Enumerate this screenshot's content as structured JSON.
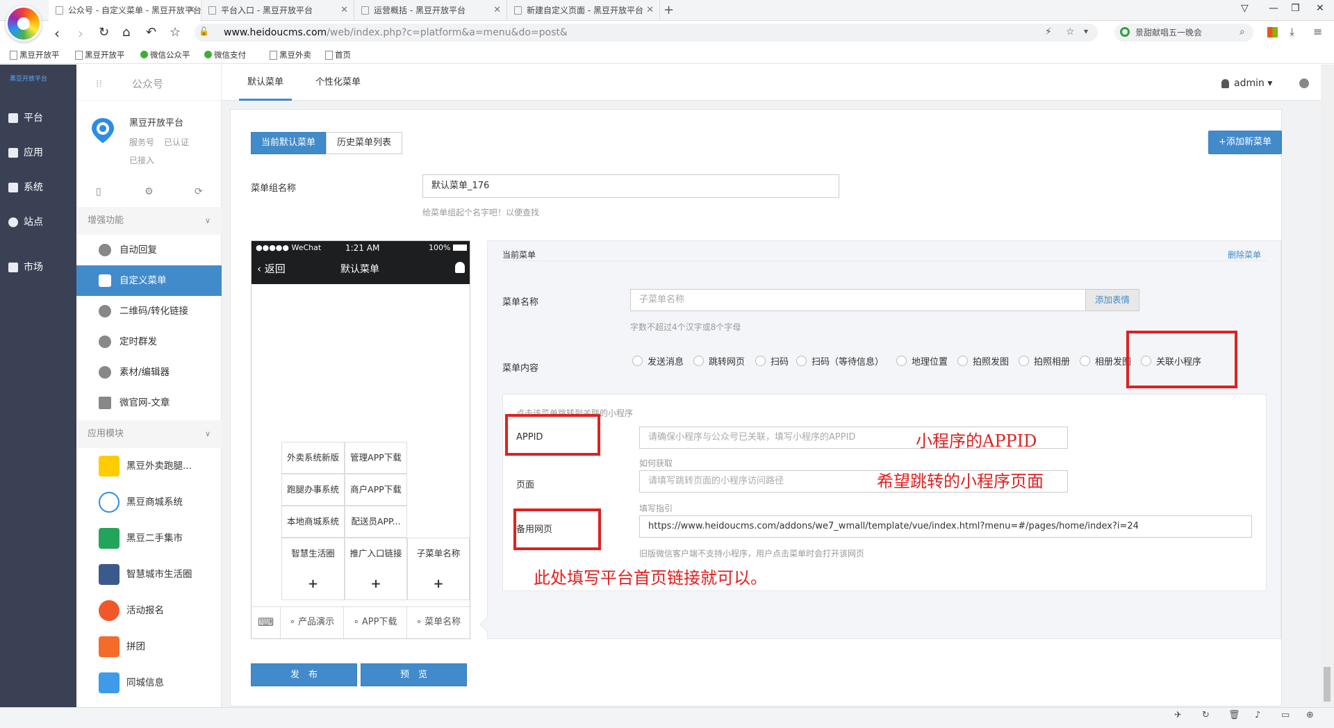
{
  "browser": {
    "tabs": [
      {
        "title": "公众号 - 自定义菜单 - 黑豆开放平台"
      },
      {
        "title": "平台入口 - 黑豆开放平台"
      },
      {
        "title": "运营概括 - 黑豆开放平台"
      },
      {
        "title": "新建自定义页面 - 黑豆开放平台"
      }
    ],
    "new_tab": "+",
    "url_domain": "www.heidoucms.com",
    "url_path": "/web/index.php?c=platform&a=menu&do=post&",
    "search_text": "景甜献唱五一晚会",
    "bookmarks": [
      "黑豆开放平",
      "黑豆开放平",
      "微信公众平",
      "微信支付",
      "黑豆外卖",
      "首页"
    ]
  },
  "leftnav": {
    "logo": "黑豆开放平台",
    "items": [
      "平台",
      "应用",
      "系统",
      "站点",
      "市场"
    ]
  },
  "sidebar": {
    "title": "公众号",
    "account_name": "黑豆开放平台",
    "account_type": "服务号",
    "account_status": "已认证",
    "account_conn": "已接入",
    "section_enhanced": "增强功能",
    "enhanced_items": [
      "自动回复",
      "自定义菜单",
      "二维码/转化链接",
      "定时群发",
      "素材/编辑器",
      "微官网-文章"
    ],
    "section_modules": "应用模块",
    "module_items": [
      "黑豆外卖跑腿...",
      "黑豆商城系统",
      "黑豆二手集市",
      "智慧城市生活圈",
      "活动报名",
      "拼团",
      "同城信息"
    ]
  },
  "topbar": {
    "tabs": [
      "默认菜单",
      "个性化菜单"
    ],
    "user": "admin"
  },
  "content": {
    "btn_current": "当前默认菜单",
    "btn_history": "历史菜单列表",
    "btn_add": "+添加新菜单",
    "group_label": "菜单组名称",
    "group_value": "默认菜单_176",
    "group_hint": "给菜单组起个名字吧！以便查找",
    "publish": "发　布",
    "preview": "预　览"
  },
  "phone": {
    "carrier": "●●●●● WeChat",
    "time": "1:21 AM",
    "battery": "100%",
    "back": "返回",
    "title": "默认菜单",
    "col1_sub": [
      "外卖系统新版",
      "跑腿办事系统",
      "本地商城系统",
      "智慧生活圈"
    ],
    "col2_sub": [
      "管理APP下载",
      "商户APP下载",
      "配送员APP...",
      "推广入口链接"
    ],
    "col3_sub": [
      "子菜单名称"
    ],
    "plus": "+",
    "bottom": [
      "产品演示",
      "APP下载",
      "菜单名称"
    ]
  },
  "editor": {
    "current_menu": "当前菜单",
    "delete": "删除菜单",
    "name_label": "菜单名称",
    "name_placeholder": "子菜单名称",
    "add_emoji": "添加表情",
    "name_hint": "字数不超过4个汉字或8个字母",
    "content_label": "菜单内容",
    "options": [
      "发送消息",
      "跳转网页",
      "扫码",
      "扫码（等待信息）",
      "地理位置",
      "拍照发图",
      "拍照相册",
      "相册发图",
      "关联小程序"
    ],
    "mini_hint": "点击该菜单跳转到关联的小程序",
    "appid_label": "APPID",
    "appid_placeholder": "请确保小程序与公众号已关联，填写小程序的APPID",
    "appid_howto": "如何获取",
    "page_label": "页面",
    "page_placeholder": "请填写跳转页面的小程序访问路径",
    "page_guide": "填写指引",
    "backup_label": "备用网页",
    "backup_value": "https://www.heidoucms.com/addons/we7_wmall/template/vue/index.html?menu=#/pages/home/index?i=24",
    "backup_hint": "旧版微信客户端不支持小程序，用户点击菜单时会打开该网页"
  },
  "annotations": {
    "appid": "小程序的APPID",
    "page": "希望跳转的小程序页面",
    "homepage": "此处填写平台首页链接就可以。"
  },
  "colors": {
    "accent": "#428bca",
    "nav_bg": "#3a4155",
    "annotation": "#e02020"
  }
}
